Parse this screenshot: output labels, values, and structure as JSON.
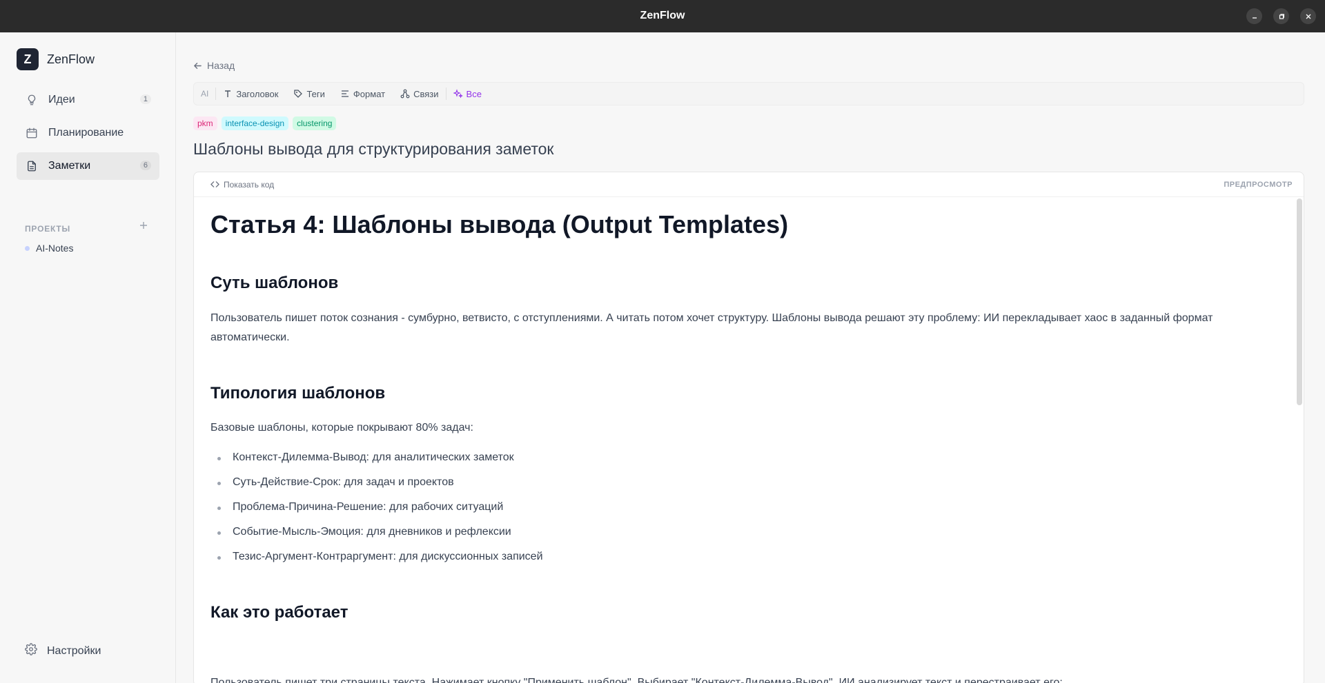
{
  "window": {
    "title": "ZenFlow"
  },
  "sidebar": {
    "brand_letter": "Z",
    "brand_name": "ZenFlow",
    "items": [
      {
        "label": "Идеи",
        "count": "1",
        "icon": "lightbulb-icon"
      },
      {
        "label": "Планирование",
        "count": "",
        "icon": "calendar-icon"
      },
      {
        "label": "Заметки",
        "count": "6",
        "icon": "document-icon",
        "active": true
      }
    ],
    "projects_header": "ПРОЕКТЫ",
    "projects": [
      {
        "label": "AI-Notes"
      }
    ],
    "settings_label": "Настройки"
  },
  "main": {
    "back_label": "Назад",
    "toolbar": {
      "ai": "AI",
      "title_btn": "Заголовок",
      "tags_btn": "Теги",
      "format_btn": "Формат",
      "links_btn": "Связи",
      "all_btn": "Все"
    },
    "tags": [
      "pkm",
      "interface-design",
      "clustering"
    ],
    "note_title": "Шаблоны вывода для структурирования заметок",
    "doc": {
      "show_code": "Показать код",
      "preview": "ПРЕДПРОСМОТР",
      "h1": "Статья 4: Шаблоны вывода (Output Templates)",
      "h2_essence": "Суть шаблонов",
      "p_essence": "Пользователь пишет поток сознания - сумбурно, ветвисто, с отступлениями. А читать потом хочет структуру. Шаблоны вывода решают эту проблему: ИИ перекладывает хаос в заданный формат автоматически.",
      "h2_typology": "Типология шаблонов",
      "p_typology": "Базовые шаблоны, которые покрывают 80% задач:",
      "list": [
        "Контекст-Дилемма-Вывод: для аналитических заметок",
        "Суть-Действие-Срок: для задач и проектов",
        "Проблема-Причина-Решение: для рабочих ситуаций",
        "Событие-Мысль-Эмоция: для дневников и рефлексии",
        "Тезис-Аргумент-Контраргумент: для дискуссионных записей"
      ],
      "h2_how": "Как это работает",
      "p_how": "Пользователь пишет три страницы текста. Нажимает кнопку \"Применить шаблон\". Выбирает \"Контекст-Дилемма-Вывод\". ИИ анализирует текст и перестраивает его:"
    }
  }
}
